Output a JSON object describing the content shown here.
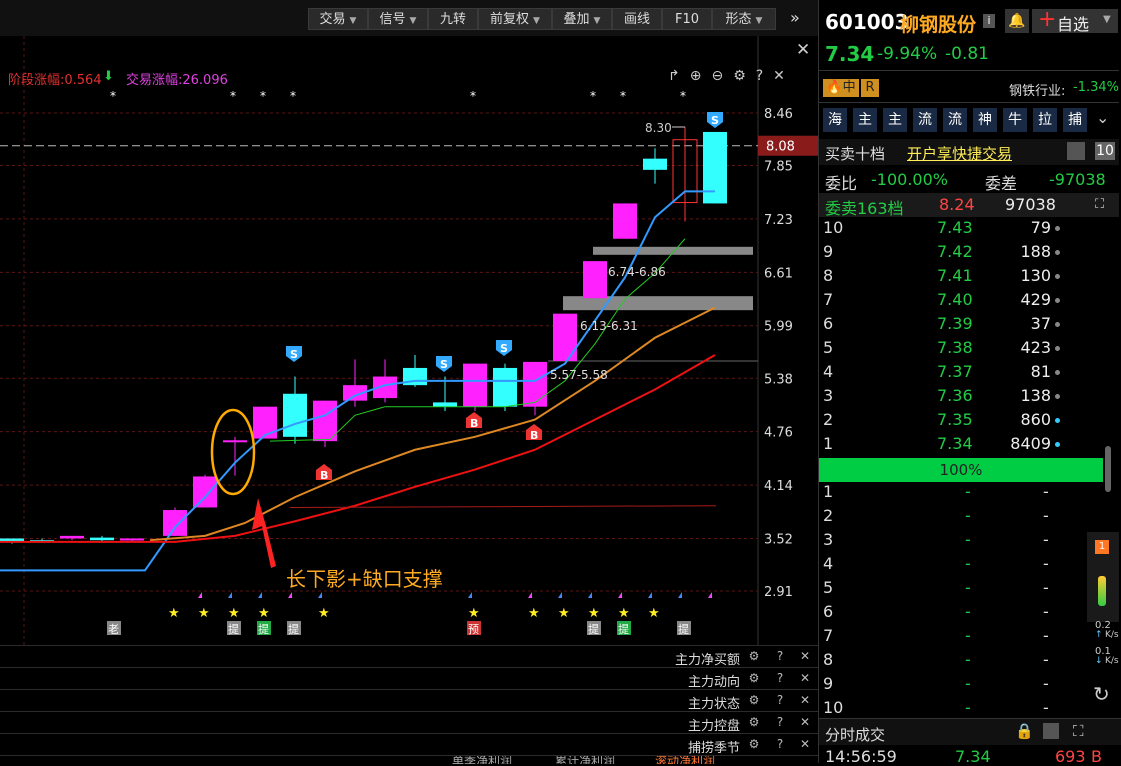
{
  "toolbar": {
    "buttons": [
      "交易",
      "信号",
      "九转",
      "前复权",
      "叠加",
      "画线",
      "F10",
      "形态"
    ],
    "more_icon": "double-chevron-right-icon",
    "close_icon": "close-icon"
  },
  "chart_header": {
    "stage_gain_label": "阶段涨幅:0.564",
    "trade_gain_label": "交易涨幅:26.096"
  },
  "chart_data": {
    "type": "candlestick",
    "y_axis_ticks": [
      "8.46",
      "7.85",
      "7.23",
      "6.61",
      "5.99",
      "5.38",
      "4.76",
      "4.14",
      "3.52",
      "2.91"
    ],
    "current_price_tag": "8.08",
    "candles": [
      {
        "o": 3.52,
        "c": 3.48,
        "h": 3.52,
        "l": 3.46,
        "color": "cyan"
      },
      {
        "o": 3.5,
        "c": 3.5,
        "h": 3.52,
        "l": 3.48,
        "color": "cyan"
      },
      {
        "o": 3.52,
        "c": 3.55,
        "h": 3.55,
        "l": 3.5,
        "color": "magenta"
      },
      {
        "o": 3.5,
        "c": 3.53,
        "h": 3.55,
        "l": 3.48,
        "color": "cyan"
      },
      {
        "o": 3.52,
        "c": 3.5,
        "h": 3.52,
        "l": 3.48,
        "color": "magenta"
      },
      {
        "o": 3.55,
        "c": 3.85,
        "h": 3.88,
        "l": 3.55,
        "color": "magenta"
      },
      {
        "o": 3.88,
        "c": 4.24,
        "h": 4.26,
        "l": 3.88,
        "color": "magenta"
      },
      {
        "o": 4.66,
        "c": 4.66,
        "h": 4.7,
        "l": 4.25,
        "color": "magenta"
      },
      {
        "o": 4.68,
        "c": 5.05,
        "h": 5.05,
        "l": 4.68,
        "color": "magenta"
      },
      {
        "o": 5.2,
        "c": 4.7,
        "h": 5.4,
        "l": 4.62,
        "color": "cyan"
      },
      {
        "o": 4.65,
        "c": 5.12,
        "h": 5.12,
        "l": 4.58,
        "color": "magenta"
      },
      {
        "o": 5.3,
        "c": 5.12,
        "h": 5.6,
        "l": 5.05,
        "color": "magenta"
      },
      {
        "o": 5.15,
        "c": 5.4,
        "h": 5.6,
        "l": 5.1,
        "color": "magenta"
      },
      {
        "o": 5.3,
        "c": 5.5,
        "h": 5.65,
        "l": 5.28,
        "color": "cyan"
      },
      {
        "o": 5.05,
        "c": 5.1,
        "h": 5.4,
        "l": 5.0,
        "color": "cyan"
      },
      {
        "o": 5.05,
        "c": 5.55,
        "h": 5.55,
        "l": 5.0,
        "color": "magenta"
      },
      {
        "o": 5.5,
        "c": 5.05,
        "h": 5.55,
        "l": 5.0,
        "color": "cyan"
      },
      {
        "o": 5.05,
        "c": 5.57,
        "h": 5.57,
        "l": 4.95,
        "color": "magenta"
      },
      {
        "o": 5.58,
        "c": 6.13,
        "h": 6.13,
        "l": 5.58,
        "color": "magenta"
      },
      {
        "o": 6.31,
        "c": 6.74,
        "h": 6.74,
        "l": 6.31,
        "color": "magenta"
      },
      {
        "o": 7.0,
        "c": 7.41,
        "h": 7.41,
        "l": 7.0,
        "color": "magenta"
      },
      {
        "o": 7.93,
        "c": 7.8,
        "h": 8.05,
        "l": 7.64,
        "color": "cyan"
      },
      {
        "o": 7.42,
        "c": 8.15,
        "h": 8.3,
        "l": 7.2,
        "color": "hollow-red"
      },
      {
        "o": 8.24,
        "c": 7.41,
        "h": 8.24,
        "l": 7.41,
        "color": "cyan"
      }
    ],
    "annotations": [
      {
        "text": "8.30",
        "type": "high-label"
      },
      {
        "text": "6.74-6.86",
        "type": "gap-label"
      },
      {
        "text": "6.13-6.31",
        "type": "gap-label"
      },
      {
        "text": "5.57-5.58",
        "type": "gap-label"
      },
      {
        "text": "长下影+缺口支撑",
        "type": "callout"
      }
    ],
    "signal_S_count": 5,
    "signal_B_count": 3,
    "bottom_markers": [
      "老",
      "提",
      "提",
      "提",
      "预",
      "提",
      "提",
      "提"
    ]
  },
  "indicators": [
    "主力净买额",
    "主力动向",
    "主力状态",
    "主力控盘",
    "捕捞季节"
  ],
  "bottom_tabs": [
    "单季净利润",
    "累计净利润",
    "滚动净利润"
  ],
  "quote": {
    "code": "601003",
    "name": "柳钢股份",
    "info_icon": "i",
    "bell_icon": "bell-icon",
    "watchlist_label": "自选",
    "price": "7.34",
    "change_pct": "-9.94%",
    "change_amt": "-0.81",
    "tag_mid": "中",
    "tag_r": "R",
    "industry_label": "钢铁行业:",
    "industry_change": "-1.34%",
    "flow_buttons": [
      "海",
      "主",
      "主",
      "流",
      "流",
      "神",
      "牛",
      "拉",
      "捕"
    ],
    "order_book_title": "买卖十档",
    "quick_trade_link": "开户享快捷交易",
    "order_ratio_label": "委比",
    "order_ratio_value": "-100.00%",
    "order_diff_label": "委差",
    "order_diff_value": "-97038",
    "ask_total_label": "委卖163档",
    "ask_total_price": "8.24",
    "ask_total_vol": "97038",
    "bids": [
      {
        "lvl": "10",
        "price": "7.43",
        "vol": "79"
      },
      {
        "lvl": "9",
        "price": "7.42",
        "vol": "188"
      },
      {
        "lvl": "8",
        "price": "7.41",
        "vol": "130"
      },
      {
        "lvl": "7",
        "price": "7.40",
        "vol": "429"
      },
      {
        "lvl": "6",
        "price": "7.39",
        "vol": "37"
      },
      {
        "lvl": "5",
        "price": "7.38",
        "vol": "423"
      },
      {
        "lvl": "4",
        "price": "7.37",
        "vol": "81"
      },
      {
        "lvl": "3",
        "price": "7.36",
        "vol": "138"
      },
      {
        "lvl": "2",
        "price": "7.35",
        "vol": "860"
      },
      {
        "lvl": "1",
        "price": "7.34",
        "vol": "8409"
      }
    ],
    "fill_pct": "100%",
    "empty_levels": [
      "1",
      "2",
      "3",
      "4",
      "5",
      "6",
      "7",
      "8",
      "9",
      "10"
    ],
    "dash": "-",
    "tick_title": "分时成交",
    "tick": {
      "time": "14:56:59",
      "price": "7.34",
      "vol": "693",
      "side": "B"
    },
    "speed_up": "0.2",
    "speed_down": "0.1",
    "speed_unit": "K/s",
    "tick_badge": "1"
  }
}
